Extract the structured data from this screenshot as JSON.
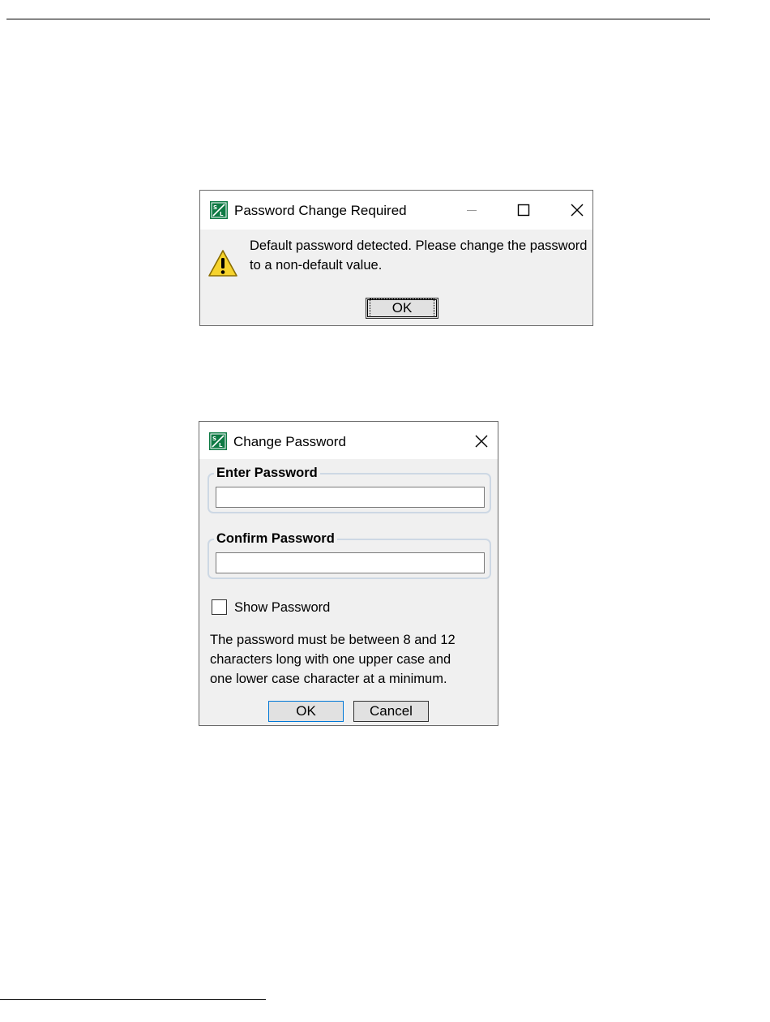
{
  "warning_dialog": {
    "title": "Password Change Required",
    "icons": {
      "app": "selinc-app-icon",
      "warning": "warning-icon"
    },
    "message_line1": "Default password detected. Please change the password",
    "message_line2": "to a non-default value.",
    "ok_label": "OK"
  },
  "change_password_dialog": {
    "title": "Change Password",
    "enter_password_label": "Enter Password",
    "enter_password_value": "",
    "confirm_password_label": "Confirm Password",
    "confirm_password_value": "",
    "show_password_label": "Show Password",
    "show_password_checked": false,
    "help_line1": "The password must be between 8 and 12",
    "help_line2": "characters long with one upper case and",
    "help_line3": "one lower case character at a minimum.",
    "ok_label": "OK",
    "cancel_label": "Cancel"
  },
  "colors": {
    "dialog_bg": "#f0f0f0",
    "icon_green": "#0e7a44",
    "warning_yellow": "#f6d32d",
    "focus_border": "#0078d7"
  }
}
